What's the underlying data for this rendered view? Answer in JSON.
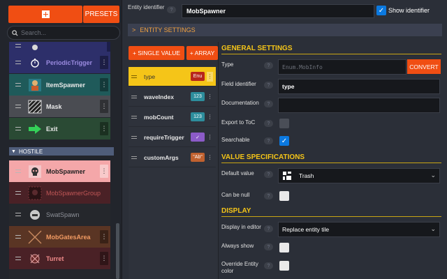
{
  "left": {
    "presets_label": "PRESETS",
    "search_placeholder": "Search...",
    "items": [
      {
        "label": "PeriodicTrigger",
        "bg": "#2d2f6a",
        "color": "#9b8be0"
      },
      {
        "label": "ItemSpawner",
        "bg": "#1f5a5a",
        "color": "#e8e8e8"
      },
      {
        "label": "Mask",
        "bg": "#4a4c52",
        "color": "#e8e8e8"
      },
      {
        "label": "Exit",
        "bg": "#2a4a34",
        "color": "#e8e8e8"
      }
    ],
    "group_label": "HOSTILE",
    "hostile_items": [
      {
        "label": "MobSpawner",
        "bg": "#f4a7a9",
        "color": "#222222"
      },
      {
        "label": "MobSpawnerGroup",
        "bg": "#4a2126",
        "color": "#c05656"
      },
      {
        "label": "SwatSpawn",
        "bg": "#25272c",
        "color": "#8d9098"
      },
      {
        "label": "MobGatesArea",
        "bg": "#5a3524",
        "color": "#f29b63"
      },
      {
        "label": "Turret",
        "bg": "#4a2126",
        "color": "#f28b8b"
      }
    ]
  },
  "top": {
    "entity_label": "Entity identifier",
    "entity_value": "MobSpawner",
    "show_identifier_label": "Show identifier",
    "section_label": "ENTITY SETTINGS"
  },
  "fields": {
    "single_value_label": "+ SINGLE VALUE",
    "array_label": "+ ARRAY",
    "items": [
      {
        "name": "type",
        "tag": "Enu",
        "tag_color": "#b8261b"
      },
      {
        "name": "waveIndex",
        "tag": "123",
        "tag_color": "#2d8d9c"
      },
      {
        "name": "mobCount",
        "tag": "123",
        "tag_color": "#2d8d9c"
      },
      {
        "name": "requireTrigger",
        "tag": "✓",
        "tag_color": "#8c5bc8"
      },
      {
        "name": "customArgs",
        "tag": "\"Ab\"",
        "tag_color": "#c0612f"
      }
    ]
  },
  "settings": {
    "general_title": "GENERAL SETTINGS",
    "type_label": "Type",
    "type_value": "Enum.MobInfo",
    "convert_label": "CONVERT",
    "field_id_label": "Field identifier",
    "field_id_value": "type",
    "documentation_label": "Documentation",
    "export_label": "Export to ToC",
    "searchable_label": "Searchable",
    "value_spec_title": "VALUE SPECIFICATIONS",
    "default_label": "Default value",
    "default_value": "Trash",
    "nullable_label": "Can be null",
    "display_title": "DISPLAY",
    "display_editor_label": "Display in editor",
    "display_editor_value": "Replace entity tile",
    "always_show_label": "Always show",
    "override_color_label": "Override Entity color"
  },
  "colors": {
    "accent": "#f04e13",
    "highlight": "#f5c518",
    "checkbox": "#0b79e0"
  }
}
